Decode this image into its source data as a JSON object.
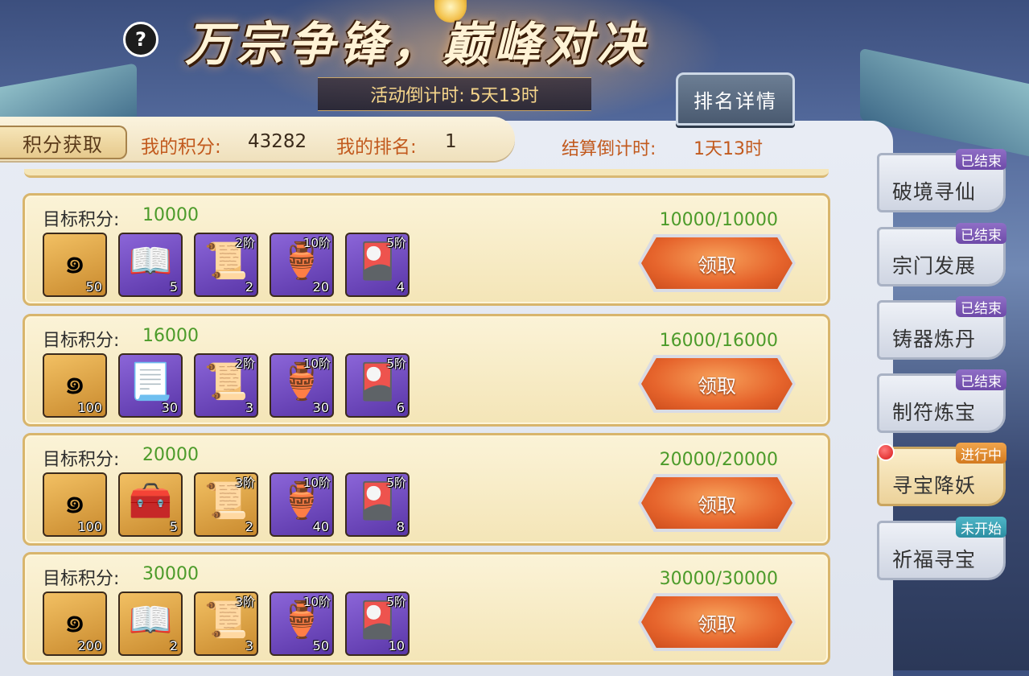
{
  "header": {
    "title": "万宗争锋，巅峰对决",
    "help_label": "?",
    "countdown_label": "活动倒计时:",
    "countdown_value": "5天13时",
    "rank_detail_label": "排名详情"
  },
  "score_bar": {
    "get_points_label": "积分获取",
    "my_points_label": "我的积分:",
    "my_points_value": "43282",
    "my_rank_label": "我的排名:",
    "my_rank_value": "1",
    "settle_label": "结算倒计时:",
    "settle_value": "1天13时"
  },
  "rewards": {
    "target_label": "目标积分:",
    "claim_label": "领取",
    "rows": [
      {
        "target": "10000",
        "progress": "10000/10000",
        "items": [
          {
            "icon": "jade-icon",
            "bg": "gold",
            "qty": "50",
            "tier": ""
          },
          {
            "icon": "book-icon",
            "bg": "purple",
            "qty": "5",
            "tier": ""
          },
          {
            "icon": "scroll-icon",
            "bg": "purple",
            "qty": "2",
            "tier": "2阶"
          },
          {
            "icon": "talisman-pouch-icon",
            "bg": "purple",
            "qty": "20",
            "tier": "10阶"
          },
          {
            "icon": "pill-cards-icon",
            "bg": "purple",
            "qty": "4",
            "tier": "5阶"
          }
        ]
      },
      {
        "target": "16000",
        "progress": "16000/16000",
        "items": [
          {
            "icon": "jade-icon",
            "bg": "gold",
            "qty": "100",
            "tier": ""
          },
          {
            "icon": "charm-paper-icon",
            "bg": "purple",
            "qty": "30",
            "tier": ""
          },
          {
            "icon": "scroll-icon",
            "bg": "purple",
            "qty": "3",
            "tier": "2阶"
          },
          {
            "icon": "talisman-pouch-icon",
            "bg": "purple",
            "qty": "30",
            "tier": "10阶"
          },
          {
            "icon": "pill-cards-icon",
            "bg": "purple",
            "qty": "6",
            "tier": "5阶"
          }
        ]
      },
      {
        "target": "20000",
        "progress": "20000/20000",
        "items": [
          {
            "icon": "jade-icon",
            "bg": "gold",
            "qty": "100",
            "tier": ""
          },
          {
            "icon": "treasure-chest-icon",
            "bg": "gold",
            "qty": "5",
            "tier": ""
          },
          {
            "icon": "scroll-icon",
            "bg": "gold",
            "qty": "2",
            "tier": "3阶"
          },
          {
            "icon": "talisman-pouch-icon",
            "bg": "purple",
            "qty": "40",
            "tier": "10阶"
          },
          {
            "icon": "pill-cards-icon",
            "bg": "purple",
            "qty": "8",
            "tier": "5阶"
          }
        ]
      },
      {
        "target": "30000",
        "progress": "30000/30000",
        "items": [
          {
            "icon": "jade-icon",
            "bg": "gold",
            "qty": "200",
            "tier": ""
          },
          {
            "icon": "book-icon",
            "bg": "gold",
            "qty": "2",
            "tier": ""
          },
          {
            "icon": "scroll-icon",
            "bg": "gold",
            "qty": "3",
            "tier": "3阶"
          },
          {
            "icon": "talisman-pouch-icon",
            "bg": "purple",
            "qty": "50",
            "tier": "10阶"
          },
          {
            "icon": "pill-cards-icon",
            "bg": "purple",
            "qty": "10",
            "tier": "5阶"
          }
        ]
      }
    ]
  },
  "tabs": [
    {
      "label": "破境寻仙",
      "status": "已结束",
      "status_type": "ended",
      "active": false
    },
    {
      "label": "宗门发展",
      "status": "已结束",
      "status_type": "ended",
      "active": false
    },
    {
      "label": "铸器炼丹",
      "status": "已结束",
      "status_type": "ended",
      "active": false
    },
    {
      "label": "制符炼宝",
      "status": "已结束",
      "status_type": "ended",
      "active": false
    },
    {
      "label": "寻宝降妖",
      "status": "进行中",
      "status_type": "active",
      "active": true
    },
    {
      "label": "祈福寻宝",
      "status": "未开始",
      "status_type": "upcoming",
      "active": false
    }
  ]
}
